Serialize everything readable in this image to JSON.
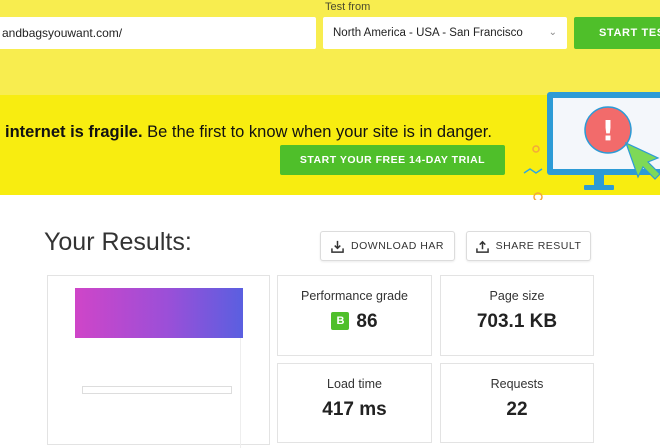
{
  "test_form": {
    "url_value": "andbagsyouwant.com/",
    "test_from_label": "Test from",
    "location_value": "North America - USA - San Francisco",
    "start_label": "START TEST"
  },
  "banner": {
    "text_bold": "internet is fragile.",
    "text_rest": " Be the first to know when your site is in danger.",
    "trial_label": "START YOUR FREE 14-DAY TRIAL",
    "exclamation": "!"
  },
  "results": {
    "title": "Your Results:",
    "download_har_label": "DOWNLOAD HAR",
    "share_result_label": "SHARE RESULT"
  },
  "metrics": {
    "performance_grade": {
      "label": "Performance grade",
      "grade": "B",
      "value": "86"
    },
    "page_size": {
      "label": "Page size",
      "value": "703.1 KB"
    },
    "load_time": {
      "label": "Load time",
      "value": "417 ms"
    },
    "requests": {
      "label": "Requests",
      "value": "22"
    }
  },
  "colors": {
    "brand_yellow": "#f8ed4f",
    "banner_yellow": "#f8ed10",
    "accent_green": "#4fbf2a",
    "alert_red": "#f26b6b"
  }
}
